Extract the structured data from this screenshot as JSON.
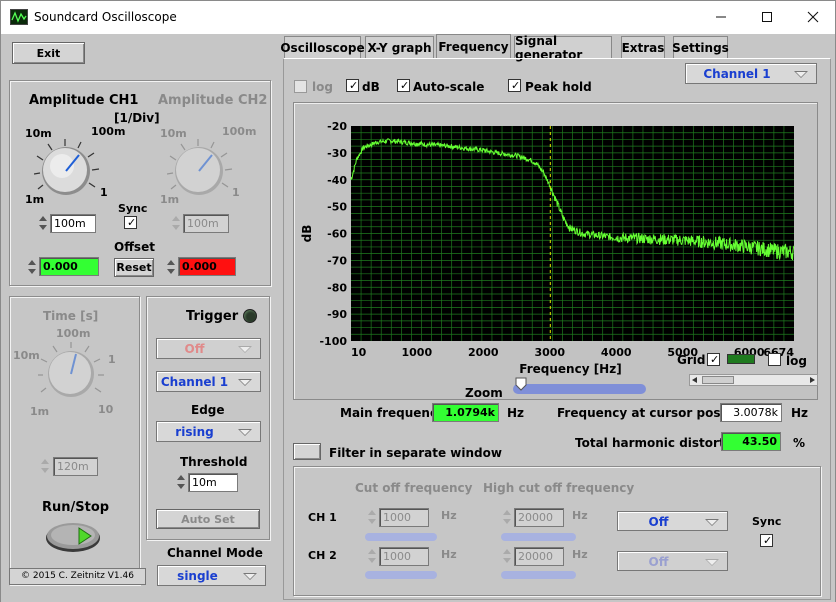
{
  "window": {
    "title": "Soundcard Oscilloscope"
  },
  "left": {
    "exit_label": "Exit",
    "amplitude": {
      "ch1_title": "Amplitude CH1",
      "ch2_title": "Amplitude CH2",
      "unit": "[1/Div]",
      "knob_labels": {
        "min": "1m",
        "lo": "10m",
        "hi": "100m",
        "max": "1"
      },
      "ch1_value": "100m",
      "ch2_value": "100m",
      "sync_label": "Sync",
      "offset_label": "Offset",
      "reset_label": "Reset",
      "ch1_offset": "0.000",
      "ch2_offset": "0.000"
    },
    "time": {
      "title": "Time [s]",
      "knob_labels": {
        "k1": "1m",
        "k2": "10m",
        "k3": "100m",
        "k4": "1",
        "k5": "10"
      },
      "value": "120m"
    },
    "run_stop_label": "Run/Stop",
    "copyright": "© 2015  C. Zeitnitz V1.46",
    "trigger": {
      "title": "Trigger",
      "mode": "Off",
      "channel": "Channel 1",
      "edge_label": "Edge",
      "edge": "rising",
      "threshold_label": "Threshold",
      "threshold": "10m",
      "auto_set_label": "Auto Set"
    },
    "channel_mode": {
      "label": "Channel Mode",
      "value": "single"
    }
  },
  "tabs": [
    {
      "label": "Oscilloscope"
    },
    {
      "label": "X-Y graph"
    },
    {
      "label": "Frequency"
    },
    {
      "label": "Signal generator"
    },
    {
      "label": "Extras"
    },
    {
      "label": "Settings"
    }
  ],
  "freq": {
    "log_label": "log",
    "db_label": "dB",
    "autoscale_label": "Auto-scale",
    "peakhold_label": "Peak hold",
    "channel_select": "Channel 1",
    "grid_label": "Grid",
    "log_x_label": "log",
    "zoom_label": "Zoom",
    "main_freq_label": "Main frequency",
    "main_freq_value": "1.0794k",
    "main_freq_unit": "Hz",
    "cursor_freq_label": "Frequency at cursor position",
    "cursor_freq_value": "3.0078k",
    "cursor_freq_unit": "Hz",
    "thd_label": "Total harmonic distortion",
    "thd_value": "43.50",
    "thd_unit": "%",
    "filter_window_label": "Filter in separate window"
  },
  "filter": {
    "cutoff_label": "Cut off frequency",
    "high_cutoff_label": "High cut off frequency",
    "hz": "Hz",
    "ch1_label": "CH 1",
    "ch2_label": "CH 2",
    "ch1_cutoff": "1000",
    "ch1_high": "20000",
    "ch2_cutoff": "1000",
    "ch2_high": "20000",
    "ch1_mode": "Off",
    "ch2_mode": "Off",
    "sync_label": "Sync"
  },
  "chart_data": {
    "type": "line",
    "title": "",
    "xlabel": "Frequency [Hz]",
    "ylabel": "dB",
    "xlim": [
      10,
      6674
    ],
    "ylim": [
      -100,
      -20
    ],
    "xticks": [
      "10",
      "1000",
      "2000",
      "3000",
      "4000",
      "5000",
      "6000",
      "6674"
    ],
    "xtick_values": [
      10,
      1000,
      2000,
      3000,
      4000,
      5000,
      6000,
      6674
    ],
    "yticks": [
      "-20",
      "-30",
      "-40",
      "-50",
      "-60",
      "-70",
      "-80",
      "-90",
      "-100"
    ],
    "ytick_values": [
      -20,
      -30,
      -40,
      -50,
      -60,
      -70,
      -80,
      -90,
      -100
    ],
    "cursor_x": 3008,
    "grid": true,
    "colors": {
      "background": "#000000",
      "grid": "#1f7a1f",
      "trace": "#66ff33",
      "cursor": "#e6e600"
    },
    "series": [
      {
        "x": [
          10,
          100,
          200,
          400,
          600,
          800,
          1000,
          1200,
          1500,
          1800,
          2000,
          2200,
          2500,
          2700,
          2800,
          2900,
          3000,
          3100,
          3200,
          3300,
          3500,
          3800,
          4000,
          4500,
          5000,
          5500,
          6000,
          6400,
          6674
        ],
        "values": [
          -40,
          -32,
          -28,
          -26,
          -25.5,
          -26,
          -26.5,
          -27,
          -27.5,
          -28.5,
          -29,
          -30,
          -31,
          -32.5,
          -34,
          -37,
          -42,
          -48,
          -54,
          -58,
          -60,
          -61,
          -61.5,
          -62,
          -62.5,
          -63.5,
          -65,
          -66.5,
          -67
        ]
      }
    ]
  }
}
